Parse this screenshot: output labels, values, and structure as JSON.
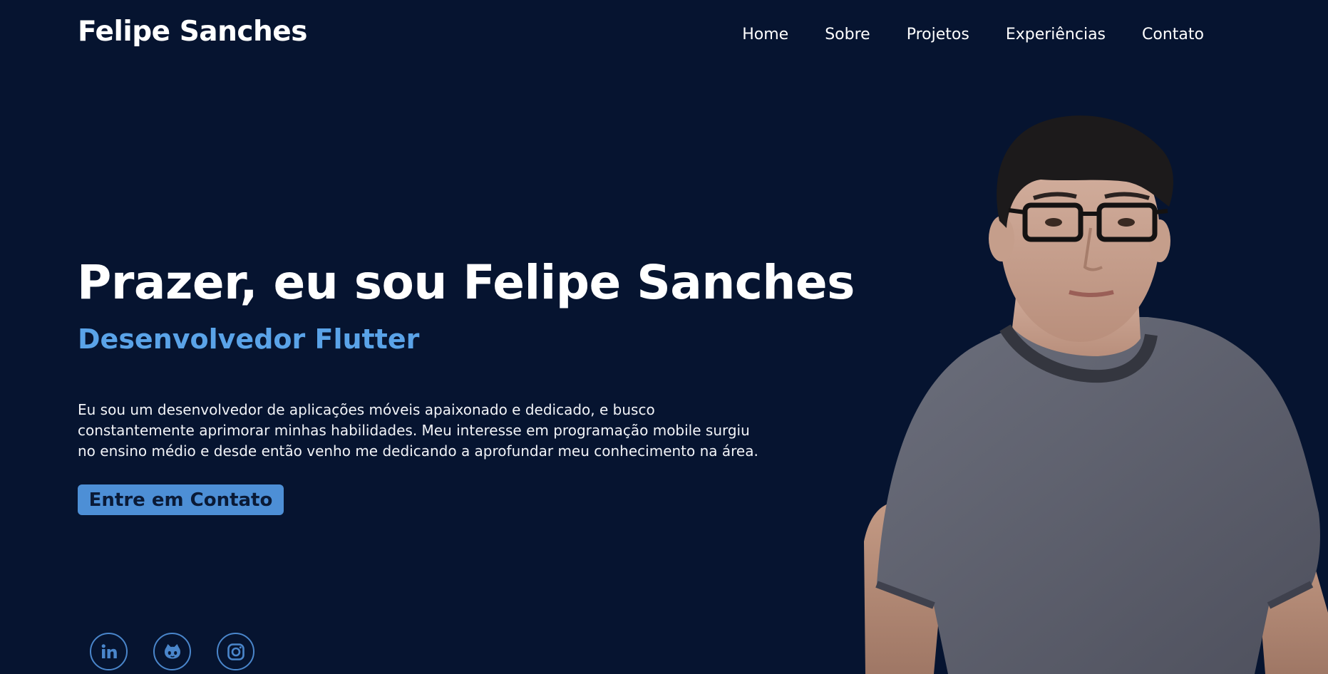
{
  "header": {
    "brand": "Felipe Sanches",
    "nav": [
      "Home",
      "Sobre",
      "Projetos",
      "Experiências",
      "Contato"
    ]
  },
  "hero": {
    "title": "Prazer, eu sou Felipe Sanches",
    "subtitle": "Desenvolvedor Flutter",
    "description_lines": [
      "Eu sou um desenvolvedor de aplicações móveis apaixonado e dedicado, e busco",
      "constantemente aprimorar minhas habilidades. Meu interesse em programação mobile surgiu",
      "no ensino médio e desde então venho me dedicando a aprofundar meu conhecimento na área."
    ],
    "cta_label": "Entre em Contato"
  },
  "socials": [
    {
      "icon": "linkedin-icon"
    },
    {
      "icon": "github-icon"
    },
    {
      "icon": "instagram-icon"
    }
  ],
  "colors": {
    "background": "#061430",
    "accent": "#5aa3e8",
    "button": "#4d8fd6",
    "button_text": "#0a1a36",
    "social_ring": "#4a86cb"
  }
}
